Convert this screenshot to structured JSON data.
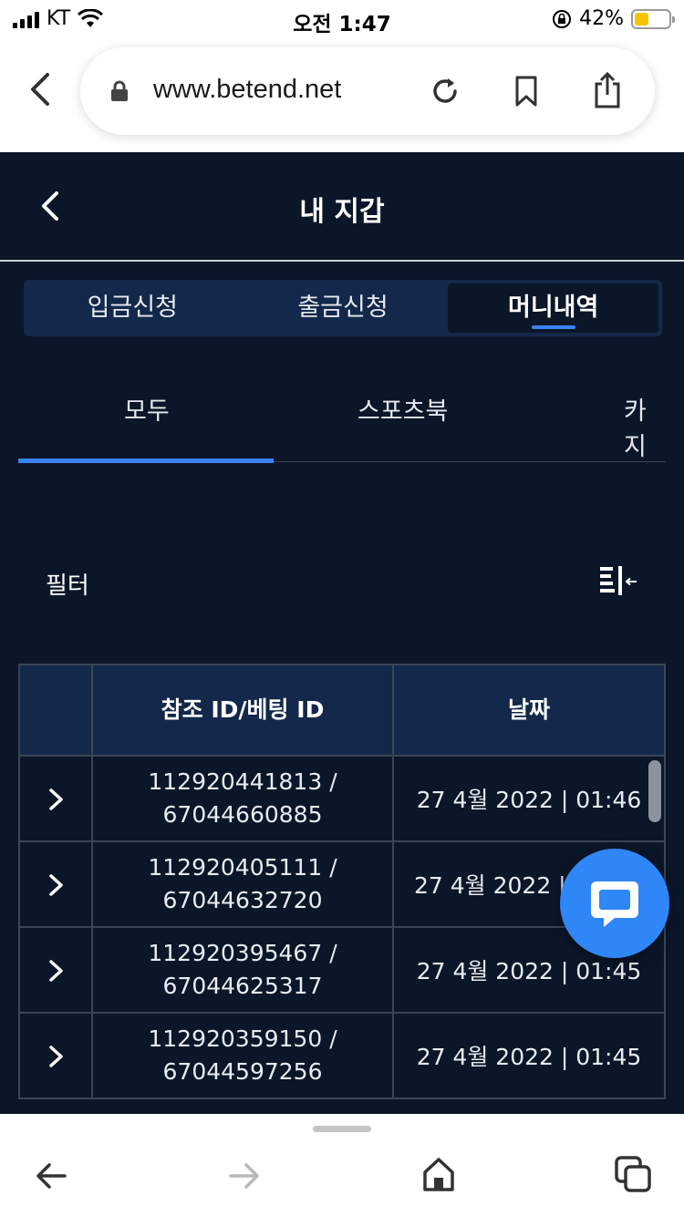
{
  "status_bar": {
    "carrier": "KT",
    "time": "오전 1:47",
    "battery_percent": "42%",
    "battery_level": 0.42
  },
  "browser": {
    "url": "www.betend.net"
  },
  "page": {
    "title": "내 지갑"
  },
  "segments": [
    {
      "label": "입금신청",
      "active": false
    },
    {
      "label": "출금신청",
      "active": false
    },
    {
      "label": "머니내역",
      "active": true
    }
  ],
  "tabs": [
    {
      "label": "모두",
      "active": true
    },
    {
      "label": "스포츠북",
      "active": false
    },
    {
      "label": "카지",
      "active": false
    }
  ],
  "filter": {
    "label": "필터"
  },
  "table": {
    "columns": [
      "",
      "참조 ID/베팅 ID",
      "날짜"
    ],
    "rows": [
      {
        "ref_id": "112920441813 /",
        "bet_id": "67044660885",
        "date": "27 4월 2022 | 01:46"
      },
      {
        "ref_id": "112920405111 /",
        "bet_id": "67044632720",
        "date": "27 4월 2022 |"
      },
      {
        "ref_id": "112920395467 /",
        "bet_id": "67044625317",
        "date": "27 4월 2022 | 01:45"
      },
      {
        "ref_id": "112920359150 /",
        "bet_id": "67044597256",
        "date": "27 4월 2022 | 01:45"
      }
    ]
  },
  "colors": {
    "app_bg": "#0b1629",
    "header_bg": "#13284a",
    "accent": "#3b82f6",
    "chat_button": "#2f86f6",
    "battery_fill": "#f5c400"
  },
  "icons": {
    "chat": "chat-bubble-icon",
    "filter": "filter-list-icon"
  }
}
